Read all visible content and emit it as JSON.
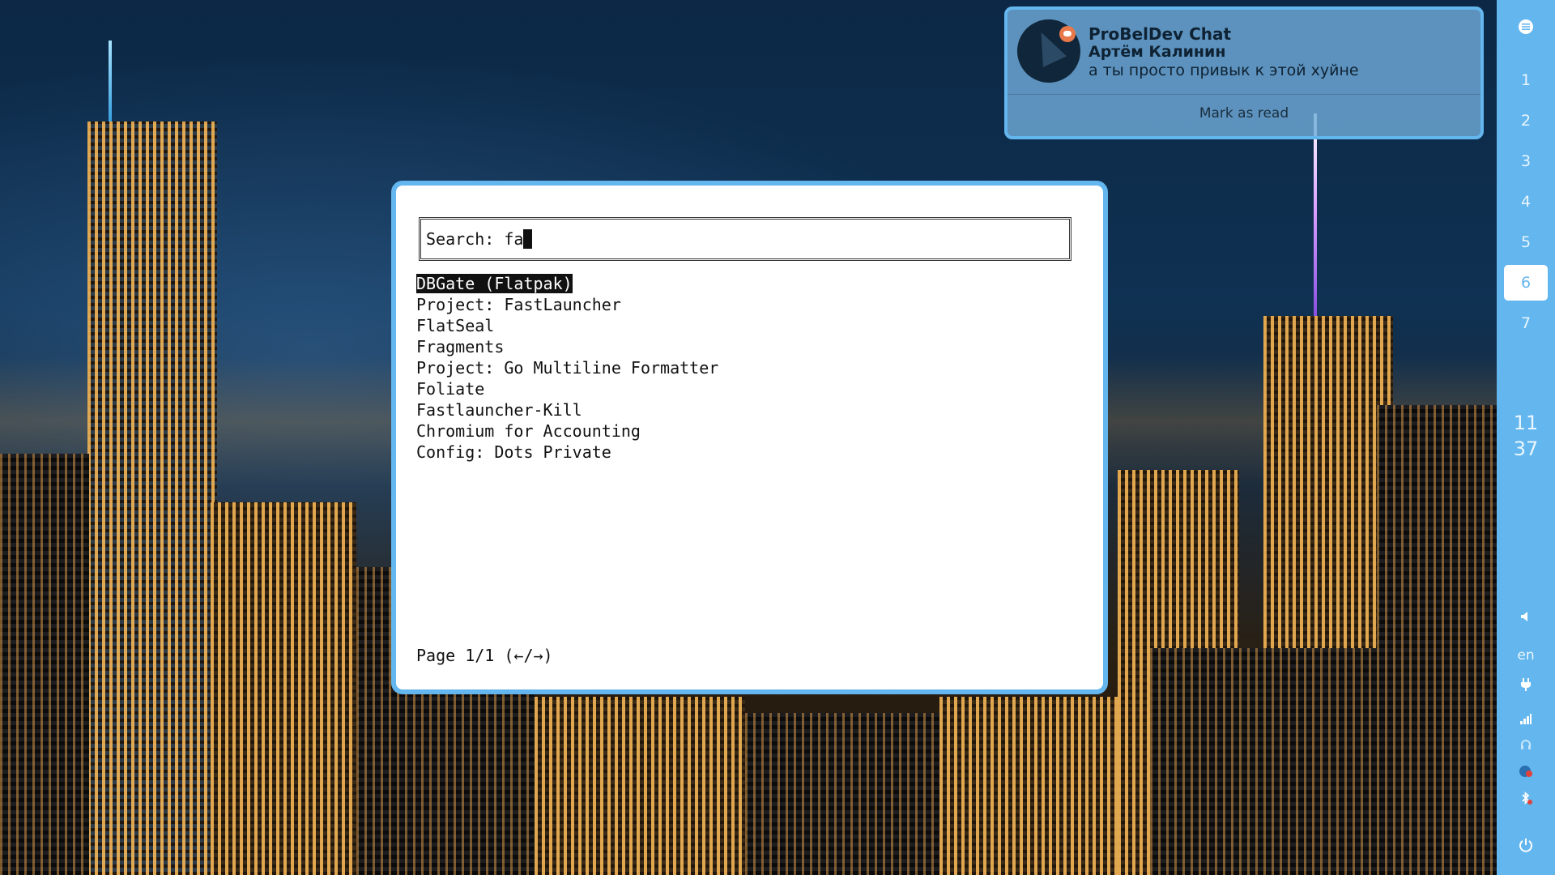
{
  "notification": {
    "app": "ProBelDev Chat",
    "sender": "Артём Калинин",
    "message": "а ты просто привык к этой хуйне",
    "action": "Mark as read"
  },
  "launcher": {
    "search_label": "Search: ",
    "search_value": "fa",
    "results": [
      "DBGate (Flatpak)",
      "Project: FastLauncher",
      "FlatSeal",
      "Fragments",
      "Project: Go Multiline Formatter",
      "Foliate",
      "Fastlauncher-Kill",
      "Chromium for Accounting",
      "Config: Dots Private"
    ],
    "selected_index": 0,
    "pager": "Page 1/1 (←/→)"
  },
  "sidebar": {
    "workspaces": [
      "1",
      "2",
      "3",
      "4",
      "5",
      "6",
      "7"
    ],
    "active_workspace": "6",
    "clock_hour": "11",
    "clock_minute": "37",
    "language": "en",
    "icons": [
      "menu-icon",
      "volume-icon",
      "power-plug-icon",
      "signal-bars-icon",
      "headphones-icon",
      "notification-dot-icon",
      "bluetooth-icon",
      "power-icon"
    ]
  },
  "colors": {
    "accent": "#63b6ee",
    "selection_bg": "#111111"
  }
}
